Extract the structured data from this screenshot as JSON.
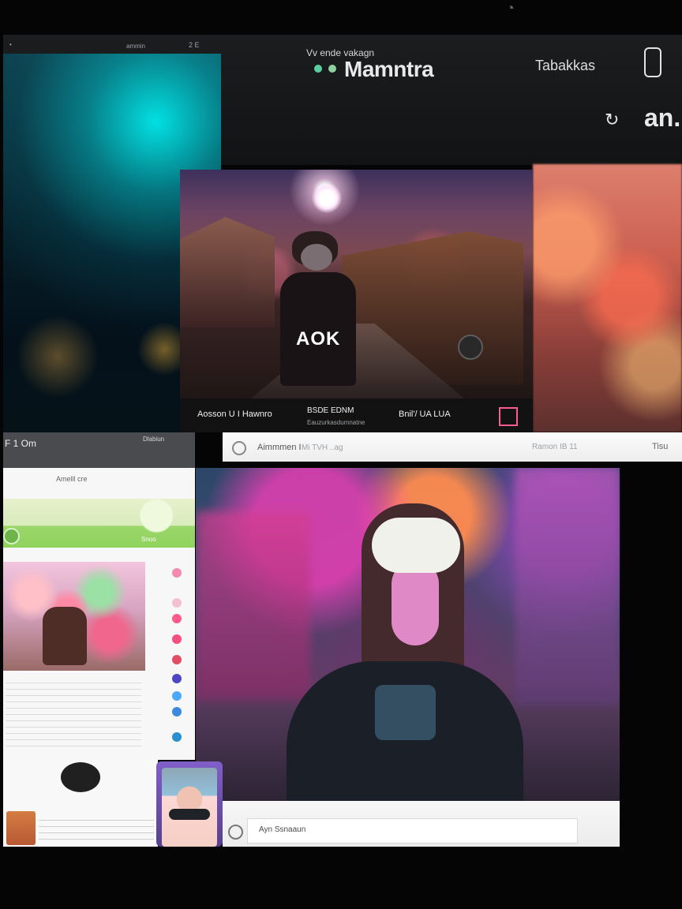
{
  "top": {
    "left_meta": "Vv ende vakagn",
    "title": "Mamntra",
    "right_meta": "Tabakkas",
    "bottom_right": "an.",
    "small_left": "ammin",
    "small_right": "2 E"
  },
  "hero": {
    "jacket_text": "AOK",
    "caption_left": "Aosson U I Hawnro",
    "caption_mid": "BSDE EDNM",
    "caption_mid_sub": "Eauzurkasdumnatne",
    "caption_right": "Bnil'/ UA LUA"
  },
  "left_bar": {
    "label": "F 1 Om",
    "meta": "Dlabiun"
  },
  "search": {
    "text": "Aimmmen I",
    "chips": "Mi TVH ..ag",
    "right_text": "Ramon IB 11",
    "right_label": "Tisu"
  },
  "content": {
    "header_small": "Amelll cre",
    "map_label": "Snoo",
    "footer_label": "Ayn Ssnaaun"
  },
  "colors": {
    "background": "#050506",
    "accent_cyan": "#39e6ff",
    "accent_pink": "#ff52b5",
    "accent_green": "#8fd35e",
    "panel": "#121212"
  },
  "icons": {
    "clock": "clock-icon",
    "phone": "phone-icon",
    "search": "search-icon",
    "refresh": "refresh-icon"
  }
}
